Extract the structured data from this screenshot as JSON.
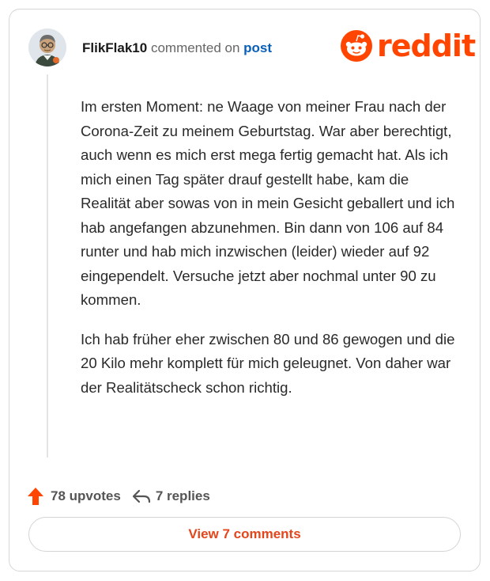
{
  "comment": {
    "author": "FlikFlak10",
    "action_text": "commented on",
    "post_link": "post",
    "avatar_icon": "avatar-icon",
    "paragraphs": [
      "Im ersten Moment: ne Waage von meiner Frau nach der Corona-Zeit zu meinem Geburtstag. War aber berechtigt, auch wenn es mich erst mega fertig gemacht hat. Als ich mich einen Tag später drauf gestellt habe, kam die Realität aber sowas von in mein Gesicht geballert und ich hab angefangen abzunehmen. Bin dann von 106 auf 84 runter und hab mich inzwischen (leider) wieder auf 92 eingependelt. Versuche jetzt aber nochmal unter 90 zu kommen.",
      "Ich hab früher eher zwischen 80 und 86 gewogen und die 20 Kilo mehr komplett für mich geleugnet. Von daher war der Realitätscheck schon richtig."
    ]
  },
  "brand": {
    "logo_text": "reddit",
    "logo_icon": "reddit-snoo-icon",
    "color": "#ff4500"
  },
  "footer": {
    "upvotes_label": "78 upvotes",
    "upvote_icon": "upvote-arrow-icon",
    "upvote_color": "#ff4500",
    "replies_label": "7 replies",
    "reply_icon": "reply-arrow-icon"
  },
  "view_button": {
    "label": "View 7 comments",
    "color": "#e4461c"
  }
}
